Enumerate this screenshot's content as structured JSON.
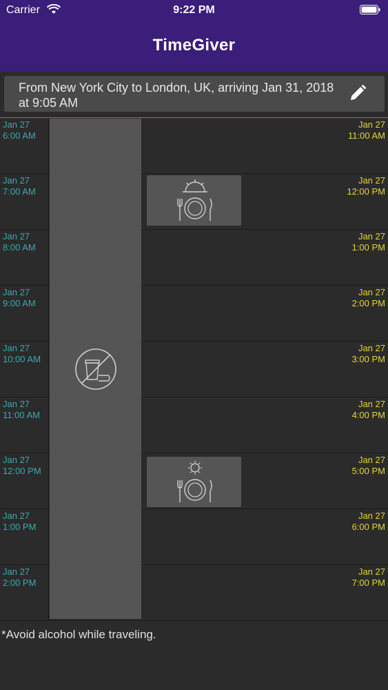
{
  "status_bar": {
    "carrier": "Carrier",
    "time": "9:22 PM"
  },
  "app": {
    "title": "TimeGiver"
  },
  "trip": {
    "summary": "From New York City to London, UK, arriving Jan 31, 2018 at 9:05 AM"
  },
  "timeline": {
    "rows": [
      {
        "left_date": "Jan 27",
        "left_time": "6:00 AM",
        "right_date": "Jan 27",
        "right_time": "11:00 AM"
      },
      {
        "left_date": "Jan 27",
        "left_time": "7:00 AM",
        "right_date": "Jan 27",
        "right_time": "12:00 PM"
      },
      {
        "left_date": "Jan 27",
        "left_time": "8:00 AM",
        "right_date": "Jan 27",
        "right_time": "1:00 PM"
      },
      {
        "left_date": "Jan 27",
        "left_time": "9:00 AM",
        "right_date": "Jan 27",
        "right_time": "2:00 PM"
      },
      {
        "left_date": "Jan 27",
        "left_time": "10:00 AM",
        "right_date": "Jan 27",
        "right_time": "3:00 PM"
      },
      {
        "left_date": "Jan 27",
        "left_time": "11:00 AM",
        "right_date": "Jan 27",
        "right_time": "4:00 PM"
      },
      {
        "left_date": "Jan 27",
        "left_time": "12:00 PM",
        "right_date": "Jan 27",
        "right_time": "5:00 PM"
      },
      {
        "left_date": "Jan 27",
        "left_time": "1:00 PM",
        "right_date": "Jan 27",
        "right_time": "6:00 PM"
      },
      {
        "left_date": "Jan 27",
        "left_time": "2:00 PM",
        "right_date": "Jan 27",
        "right_time": "7:00 PM"
      }
    ],
    "blocks": [
      {
        "type": "fasting",
        "icon": "no-caffeine-icon"
      },
      {
        "type": "meal",
        "icon": "breakfast-icon"
      },
      {
        "type": "meal",
        "icon": "lunch-icon"
      }
    ]
  },
  "footer": {
    "note": "*Avoid alcohol while traveling."
  },
  "colors": {
    "header": "#3b1d7a",
    "origin_time": "#3ba8b0",
    "destination_time": "#e4d53a",
    "background": "#2b2b2b",
    "block": "#555555"
  }
}
